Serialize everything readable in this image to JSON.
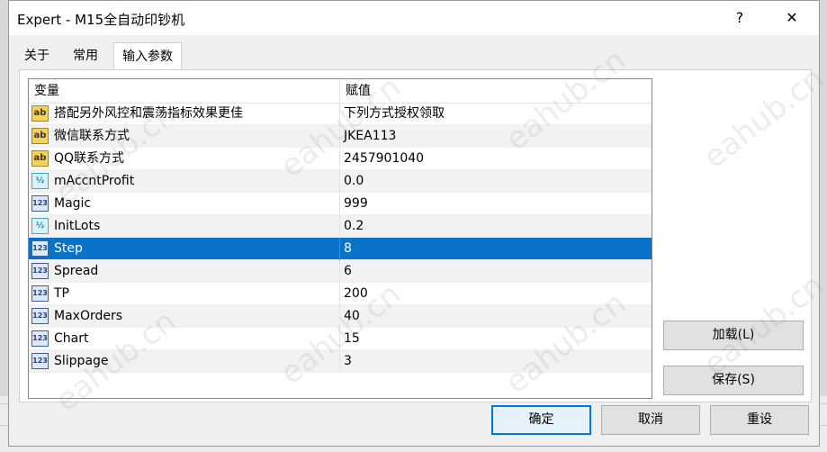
{
  "window": {
    "title": "Expert - M15全自动印钞机",
    "help_label": "?",
    "close_label": "✕"
  },
  "tabs": [
    {
      "label": "关于"
    },
    {
      "label": "常用"
    },
    {
      "label": "输入参数",
      "active": true
    }
  ],
  "table": {
    "columns": [
      "变量",
      "赋值"
    ],
    "rows": [
      {
        "icon": "string-type-icon",
        "icon_text": "ab",
        "name": "搭配另外风控和震荡指标效果更佳",
        "value": "下列方式授权领取"
      },
      {
        "icon": "string-type-icon",
        "icon_text": "ab",
        "name": "微信联系方式",
        "value": "JKEA113"
      },
      {
        "icon": "string-type-icon",
        "icon_text": "ab",
        "name": "QQ联系方式",
        "value": "2457901040"
      },
      {
        "icon": "double-type-icon",
        "icon_text": "½",
        "name": "mAccntProfit",
        "value": "0.0"
      },
      {
        "icon": "integer-type-icon",
        "icon_text": "123",
        "name": "Magic",
        "value": "999"
      },
      {
        "icon": "double-type-icon",
        "icon_text": "½",
        "name": "InitLots",
        "value": "0.2"
      },
      {
        "icon": "integer-type-icon",
        "icon_text": "123",
        "name": "Step",
        "value": "8",
        "selected": true
      },
      {
        "icon": "integer-type-icon",
        "icon_text": "123",
        "name": "Spread",
        "value": "6"
      },
      {
        "icon": "integer-type-icon",
        "icon_text": "123",
        "name": "TP",
        "value": "200"
      },
      {
        "icon": "integer-type-icon",
        "icon_text": "123",
        "name": "MaxOrders",
        "value": "40"
      },
      {
        "icon": "integer-type-icon",
        "icon_text": "123",
        "name": "Chart",
        "value": "15"
      },
      {
        "icon": "integer-type-icon",
        "icon_text": "123",
        "name": "Slippage",
        "value": "3"
      }
    ]
  },
  "side_buttons": {
    "load_label": "加载(L)",
    "save_label": "保存(S)"
  },
  "footer_buttons": {
    "ok_label": "确定",
    "cancel_label": "取消",
    "reset_label": "重设"
  },
  "watermark_text": "eahub.cn",
  "colors": {
    "selection": "#0a72c8",
    "default_button_border": "#0078d7"
  }
}
